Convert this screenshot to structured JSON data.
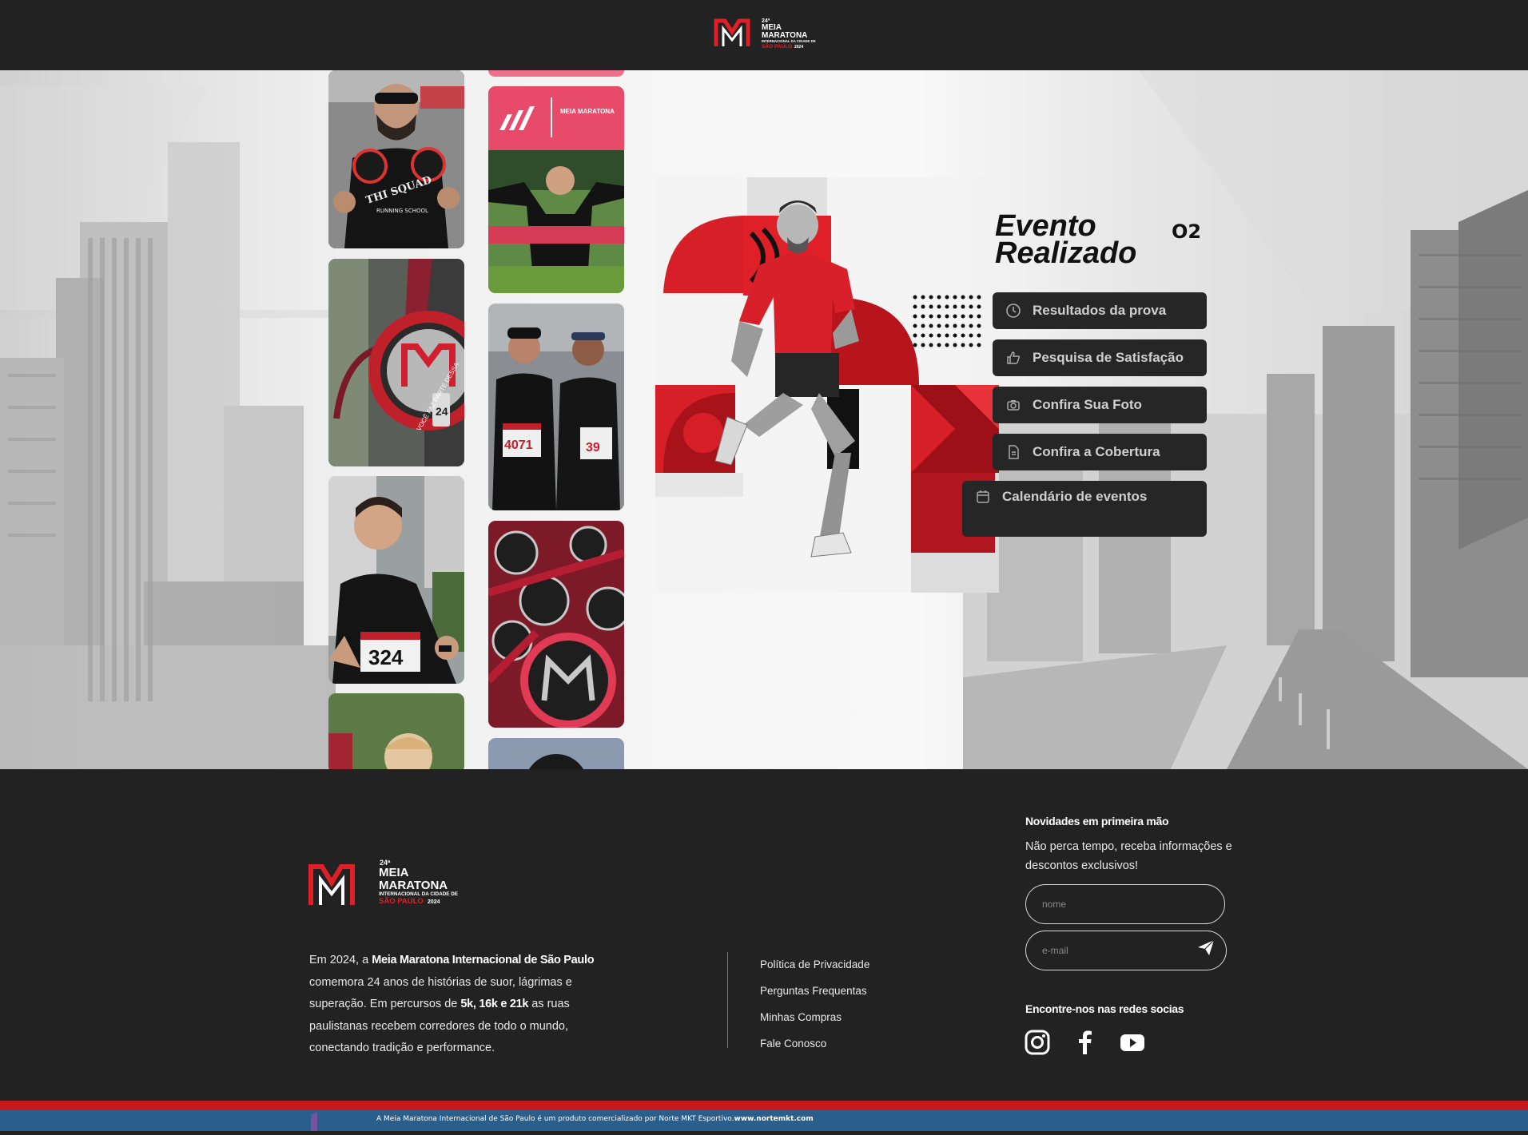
{
  "brand": {
    "edition": "24ª",
    "line1": "MEIA",
    "line2": "MARATONA",
    "line3": "INTERNACIONAL DA CIDADE DE",
    "line4": "SÃO PAULO",
    "year": "2024",
    "accent": "#e01f26"
  },
  "hero": {
    "title_line1": "Evento",
    "title_line2": "Realizado",
    "partner": "O2",
    "banner_text": "MEIA MARATONA",
    "shirt1": "THI SQUAD",
    "shirt1_sub": "RUNNING SCHOOL",
    "bib1": "4071",
    "bib2": "39",
    "bib3": "324",
    "medal_text": "VOCÊ FAZ PARTE DESSA",
    "buttons": [
      {
        "label": "Resultados da prova",
        "icon": "clock-icon"
      },
      {
        "label": "Pesquisa de Satisfação",
        "icon": "thumbs-up-icon"
      },
      {
        "label": "Confira Sua Foto",
        "icon": "camera-icon"
      },
      {
        "label": "Confira a Cobertura",
        "icon": "document-icon"
      },
      {
        "label": "Calendário de eventos",
        "icon": "calendar-icon"
      }
    ]
  },
  "footer": {
    "about_pre": "Em 2024, a ",
    "about_bold1": "Meia Maratona Internacional de São Paulo",
    "about_mid1": " comemora 24 anos de histórias de suor, lágrimas e superação. Em percursos de ",
    "about_bold2": "5k, 16k e 21k",
    "about_post": " as ruas paulistanas recebem corredores de todo o mundo, conectando tradição e performance.",
    "links": [
      "Política de Privacidade",
      "Perguntas Frequentas",
      "Minhas Compras",
      "Fale Conosco"
    ],
    "newsletter_title": "Novidades em primeira mão",
    "newsletter_text": "Não perca tempo, receba informações e descontos exclusivos!",
    "name_placeholder": "nome",
    "email_placeholder": "e-mail",
    "social_title": "Encontre-nos nas redes socias",
    "social": [
      "instagram-icon",
      "facebook-icon",
      "youtube-icon"
    ],
    "legal_pre": "A Meia Maratona Internacional de São Paulo é um produto comercializado por Norte MKT Esportivo.",
    "legal_link": "www.nortemkt.com"
  }
}
